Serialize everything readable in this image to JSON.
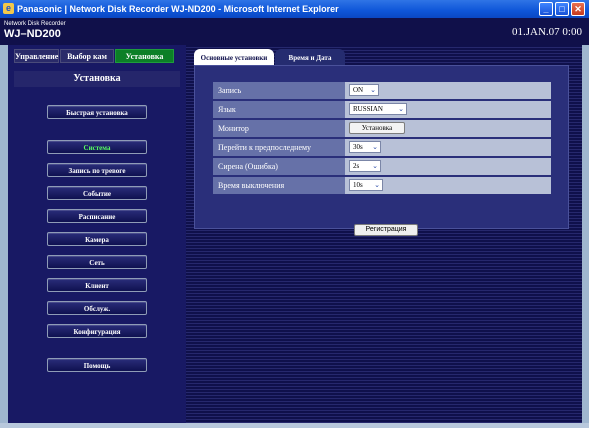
{
  "window": {
    "title": "Panasonic | Network Disk Recorder WJ-ND200 - Microsoft Internet Explorer"
  },
  "app": {
    "product_line": "Network Disk Recorder",
    "model": "WJ–ND200",
    "datetime": "01.JAN.07  0:00"
  },
  "top_tabs": [
    {
      "label": "Управление",
      "active": false
    },
    {
      "label": "Выбор кам",
      "active": false
    },
    {
      "label": "Установка",
      "active": true
    }
  ],
  "sidebar": {
    "title": "Установка",
    "buttons": [
      {
        "label": "Быстрая установка",
        "active": false
      },
      {
        "label": "Система",
        "active": true
      },
      {
        "label": "Запись по тревоге",
        "active": false
      },
      {
        "label": "Событие",
        "active": false
      },
      {
        "label": "Расписание",
        "active": false
      },
      {
        "label": "Камера",
        "active": false
      },
      {
        "label": "Сеть",
        "active": false
      },
      {
        "label": "Клиент",
        "active": false
      },
      {
        "label": "Обслуж.",
        "active": false
      },
      {
        "label": "Конфигурация",
        "active": false
      },
      {
        "label": "Помощь",
        "active": false
      }
    ]
  },
  "main_tabs": [
    {
      "label": "Основные установки",
      "active": true
    },
    {
      "label": "Время и Дата",
      "active": false
    }
  ],
  "settings": [
    {
      "label": "Запись",
      "type": "select",
      "value": "ON"
    },
    {
      "label": "Язык",
      "type": "select",
      "value": "RUSSIAN"
    },
    {
      "label": "Монитор",
      "type": "button",
      "value": "Установка"
    },
    {
      "label": "Перейти к предпоследнему",
      "type": "select",
      "value": "30s"
    },
    {
      "label": "Сирена (Ошибка)",
      "type": "select",
      "value": "2s"
    },
    {
      "label": "Время выключения",
      "type": "select",
      "value": "10s"
    }
  ],
  "register_button": "Регистрация",
  "colors": {
    "titlebar": "#0e55d8",
    "appbar": "#10104a",
    "active_tab": "#0c7f27",
    "active_sidebar_text": "#57ff62",
    "settings_row": "#6671a8",
    "settings_value_bg": "#b8c1d7"
  },
  "icons": {
    "minimize": "minimize-icon",
    "restore": "restore-icon",
    "close": "close-icon",
    "dropdown": "chevron-down-icon"
  }
}
